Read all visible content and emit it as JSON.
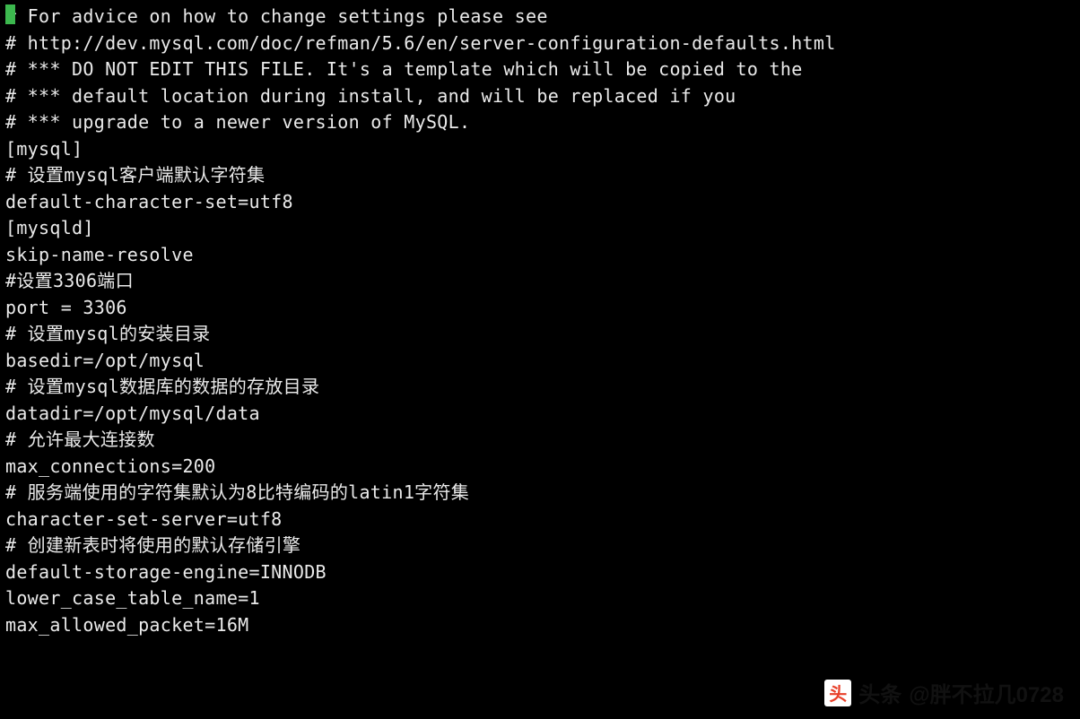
{
  "lines": [
    "# For advice on how to change settings please see",
    "# http://dev.mysql.com/doc/refman/5.6/en/server-configuration-defaults.html",
    "# *** DO NOT EDIT THIS FILE. It's a template which will be copied to the",
    "# *** default location during install, and will be replaced if you",
    "# *** upgrade to a newer version of MySQL.",
    "",
    "[mysql]",
    "# 设置mysql客户端默认字符集",
    "default-character-set=utf8",
    "",
    "[mysqld]",
    "skip-name-resolve",
    "#设置3306端口",
    "port = 3306",
    "# 设置mysql的安装目录",
    "basedir=/opt/mysql",
    "# 设置mysql数据库的数据的存放目录",
    "datadir=/opt/mysql/data",
    "# 允许最大连接数",
    "max_connections=200",
    "# 服务端使用的字符集默认为8比特编码的latin1字符集",
    "character-set-server=utf8",
    "# 创建新表时将使用的默认存储引擎",
    "default-storage-engine=INNODB",
    "lower_case_table_name=1",
    "max_allowed_packet=16M"
  ],
  "cursor_line": 0,
  "watermark": {
    "logo_text": "头",
    "label": "头条",
    "handle": "@胖不拉几0728"
  }
}
